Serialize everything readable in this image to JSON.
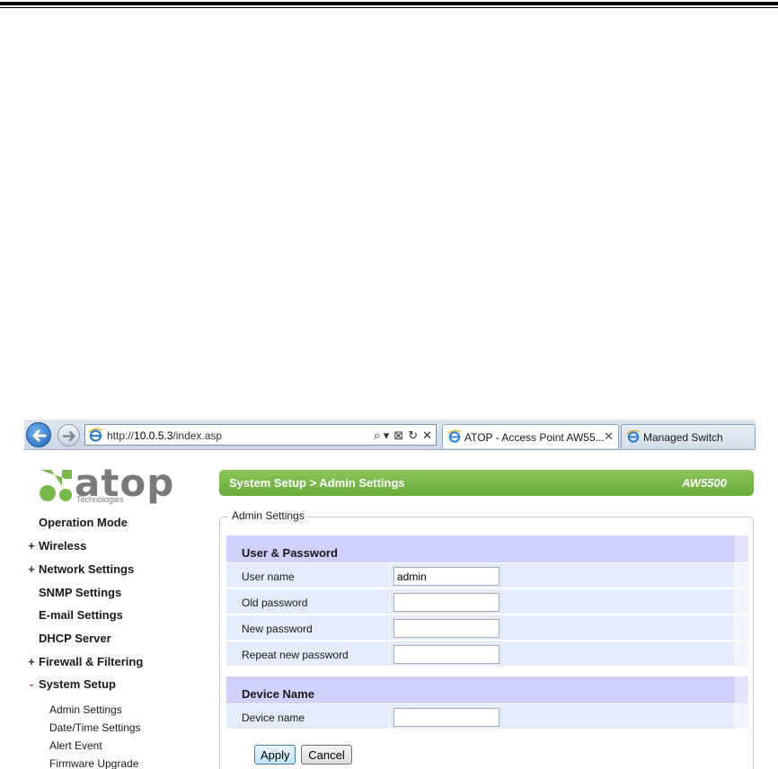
{
  "browser": {
    "url_prefix": "http://",
    "url_host": "10.0.5.3",
    "url_path": "/index.asp",
    "active_tab": "ATOP - Access Point AW55...",
    "other_tab": "Managed Switch",
    "search_icon": "⌕ ▾",
    "compat_icon": "⊠",
    "refresh_icon": "↻",
    "stop_icon": "✕",
    "tab_close": "✕"
  },
  "logo": {
    "text": "atop",
    "sub": "Technologies"
  },
  "menu": {
    "items": [
      {
        "marker": "",
        "label": "Operation Mode"
      },
      {
        "marker": "+",
        "label": "Wireless"
      },
      {
        "marker": "+",
        "label": "Network Settings"
      },
      {
        "marker": "",
        "label": "SNMP Settings"
      },
      {
        "marker": "",
        "label": "E-mail Settings"
      },
      {
        "marker": "",
        "label": "DHCP Server"
      },
      {
        "marker": "+",
        "label": "Firewall & Filtering"
      },
      {
        "marker": "-",
        "label": "System Setup"
      }
    ],
    "sub_items": [
      "Admin Settings",
      "Date/Time Settings",
      "Alert Event",
      "Firmware Upgrade"
    ]
  },
  "header": {
    "breadcrumb": "System Setup > Admin Settings",
    "model": "AW5500"
  },
  "form": {
    "legend": "Admin Settings",
    "section_user": "User & Password",
    "rows_user": [
      {
        "label": "User name",
        "value": "admin"
      },
      {
        "label": "Old password",
        "value": ""
      },
      {
        "label": "New password",
        "value": ""
      },
      {
        "label": "Repeat new password",
        "value": ""
      }
    ],
    "section_device": "Device Name",
    "rows_device": [
      {
        "label": "Device name",
        "value": ""
      }
    ],
    "apply_label": "Apply",
    "cancel_label": "Cancel"
  },
  "colors": {
    "header_green": "#78b548",
    "section_lavender": "#cfd0fb",
    "row_blue": "#e4ebfa",
    "minus_red": "#e0302a"
  }
}
